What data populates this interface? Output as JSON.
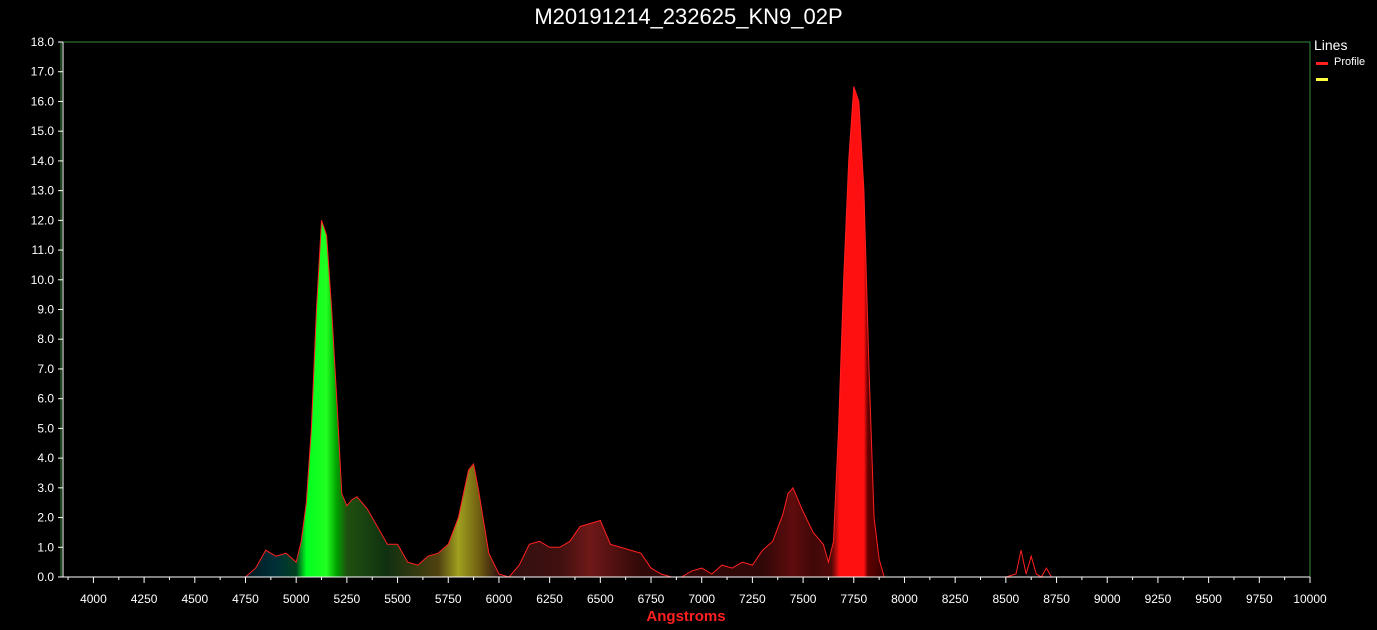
{
  "chart_data": {
    "type": "area",
    "title": "M20191214_232625_KN9_02P",
    "xlabel": "Angstroms",
    "ylabel": "",
    "xlim": [
      3850,
      10000
    ],
    "ylim": [
      0,
      18.0
    ],
    "x_ticks": [
      4000,
      4250,
      4500,
      4750,
      5000,
      5250,
      5500,
      5750,
      6000,
      6250,
      6500,
      6750,
      7000,
      7250,
      7500,
      7750,
      8000,
      8250,
      8500,
      8750,
      9000,
      9250,
      9500,
      9750,
      10000
    ],
    "y_ticks": [
      0,
      1,
      2,
      3,
      4,
      5,
      6,
      7,
      8,
      9,
      10,
      11,
      12,
      13,
      14,
      15,
      16,
      17,
      18
    ],
    "grid": false,
    "legend": {
      "title": "Lines",
      "placement": "right",
      "entries": [
        {
          "label": "Profile",
          "color": "#ff2020"
        },
        {
          "label": "",
          "color": "#ffff40"
        }
      ]
    },
    "colors": {
      "background": "#000000",
      "frame": "#3a8a3a",
      "axis": "#ffffff",
      "profile_line": "#ff2020",
      "xlabel": "#ff2020"
    },
    "series": [
      {
        "name": "Profile",
        "x": [
          4750,
          4800,
          4850,
          4900,
          4950,
          5000,
          5025,
          5050,
          5075,
          5100,
          5125,
          5150,
          5175,
          5200,
          5225,
          5250,
          5275,
          5300,
          5350,
          5400,
          5450,
          5500,
          5550,
          5600,
          5650,
          5700,
          5750,
          5800,
          5825,
          5850,
          5875,
          5900,
          5950,
          6000,
          6050,
          6100,
          6150,
          6200,
          6250,
          6300,
          6350,
          6400,
          6450,
          6500,
          6550,
          6600,
          6650,
          6700,
          6750,
          6800,
          6850,
          6900,
          6950,
          7000,
          7050,
          7100,
          7150,
          7200,
          7250,
          7300,
          7350,
          7400,
          7425,
          7450,
          7500,
          7550,
          7600,
          7625,
          7650,
          7675,
          7700,
          7725,
          7750,
          7775,
          7800,
          7825,
          7850,
          7875,
          7900,
          7950,
          8000,
          8050,
          8100,
          8150,
          8200,
          8250,
          8300,
          8350,
          8400,
          8450,
          8500,
          8550,
          8575,
          8600,
          8625,
          8650,
          8675,
          8700,
          8725,
          8750,
          8775,
          8800,
          8850,
          8900,
          8950,
          9000,
          9500,
          10000
        ],
        "values": [
          0,
          0.3,
          0.9,
          0.7,
          0.8,
          0.5,
          1.2,
          2.5,
          5.0,
          9.0,
          12.0,
          11.5,
          9.0,
          6.0,
          2.8,
          2.4,
          2.6,
          2.7,
          2.3,
          1.7,
          1.1,
          1.1,
          0.5,
          0.4,
          0.7,
          0.8,
          1.1,
          2.0,
          2.8,
          3.6,
          3.8,
          2.9,
          0.8,
          0.1,
          0,
          0.4,
          1.1,
          1.2,
          1.0,
          1.0,
          1.2,
          1.7,
          1.8,
          1.9,
          1.1,
          1.0,
          0.9,
          0.8,
          0.3,
          0.1,
          0,
          0,
          0.2,
          0.3,
          0.1,
          0.4,
          0.3,
          0.5,
          0.4,
          0.9,
          1.2,
          2.1,
          2.8,
          3.0,
          2.2,
          1.5,
          1.1,
          0.5,
          1.2,
          5.0,
          10.0,
          14.0,
          16.5,
          16.0,
          13.0,
          7.0,
          2.0,
          0.6,
          0,
          0,
          0,
          0,
          0,
          0,
          0,
          0,
          0,
          0,
          0,
          0,
          0,
          0.1,
          0.9,
          0.1,
          0.7,
          0.1,
          0,
          0.3,
          0,
          0,
          0,
          0,
          0,
          0,
          0,
          0,
          0,
          0
        ]
      }
    ]
  }
}
